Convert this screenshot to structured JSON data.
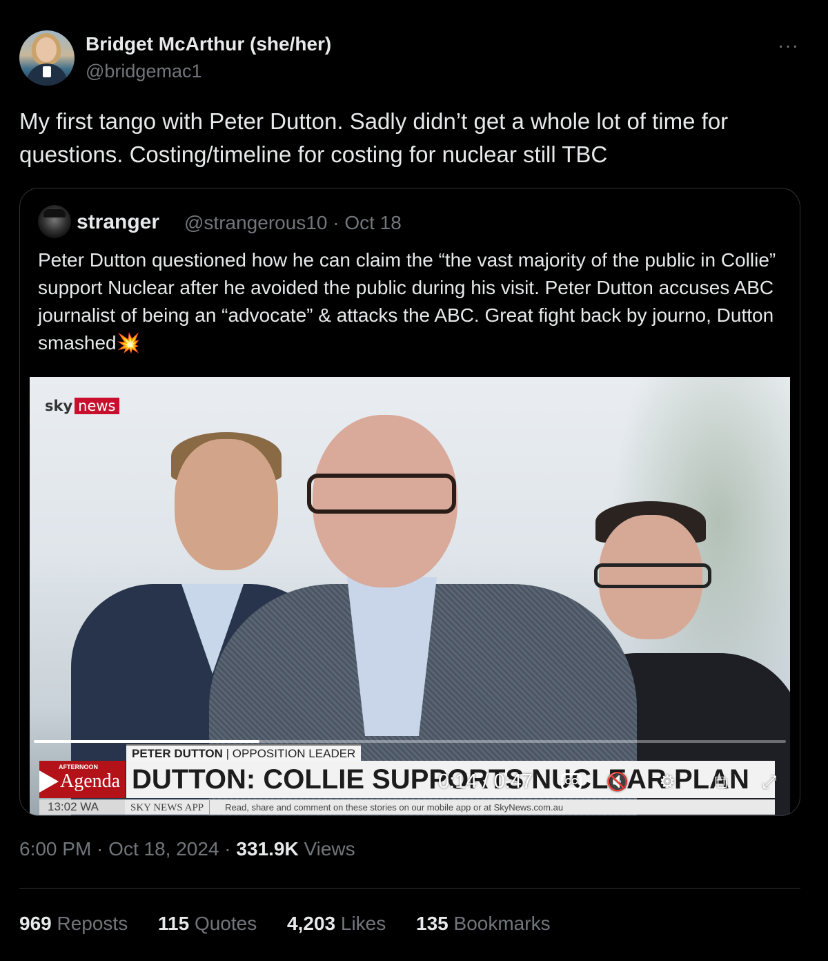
{
  "author": {
    "name": "Bridget McArthur (she/her)",
    "handle": "@bridgemac1"
  },
  "more_icon": "···",
  "tweet": {
    "text": "My first tango with Peter Dutton. Sadly didn’t get a whole lot of time for questions. Costing/timeline for costing for nuclear still TBC"
  },
  "quote": {
    "name": "stranger",
    "handle_date": "@strangerous10 · Oct 18",
    "text": "Peter Dutton questioned how he can claim the “the vast majority of the public in Collie” support Nuclear after he avoided the public during his visit. Peter Dutton accuses ABC journalist of being an “advocate” & attacks the ABC. Great fight back by journo, Dutton smashed",
    "emoji": "💥"
  },
  "video": {
    "logo_sky": "sky",
    "logo_news": "news",
    "name_strap": "PETER DUTTON",
    "name_title": "| OPPOSITION LEADER",
    "program_small": "AFTERNOON",
    "program_big": "Agenda",
    "headline": "DUTTON: COLLIE SUPPORTS NUCLEAR PLAN",
    "ticker_time": "13:02 WA",
    "ticker_app": "SKY NEWS APP",
    "ticker_msg": "Read, share and comment on these stories on our mobile app or at SkyNews.com.au",
    "time_display": "0:14 / 0:47",
    "progress": 0.3,
    "cc_label": "CC"
  },
  "meta": {
    "time_date": "6:00 PM · Oct 18, 2024 · ",
    "views_count": "331.9K",
    "views_label": " Views"
  },
  "stats": [
    {
      "count": "969",
      "label": " Reposts"
    },
    {
      "count": "115",
      "label": " Quotes"
    },
    {
      "count": "4,203",
      "label": " Likes"
    },
    {
      "count": "135",
      "label": " Bookmarks"
    }
  ]
}
